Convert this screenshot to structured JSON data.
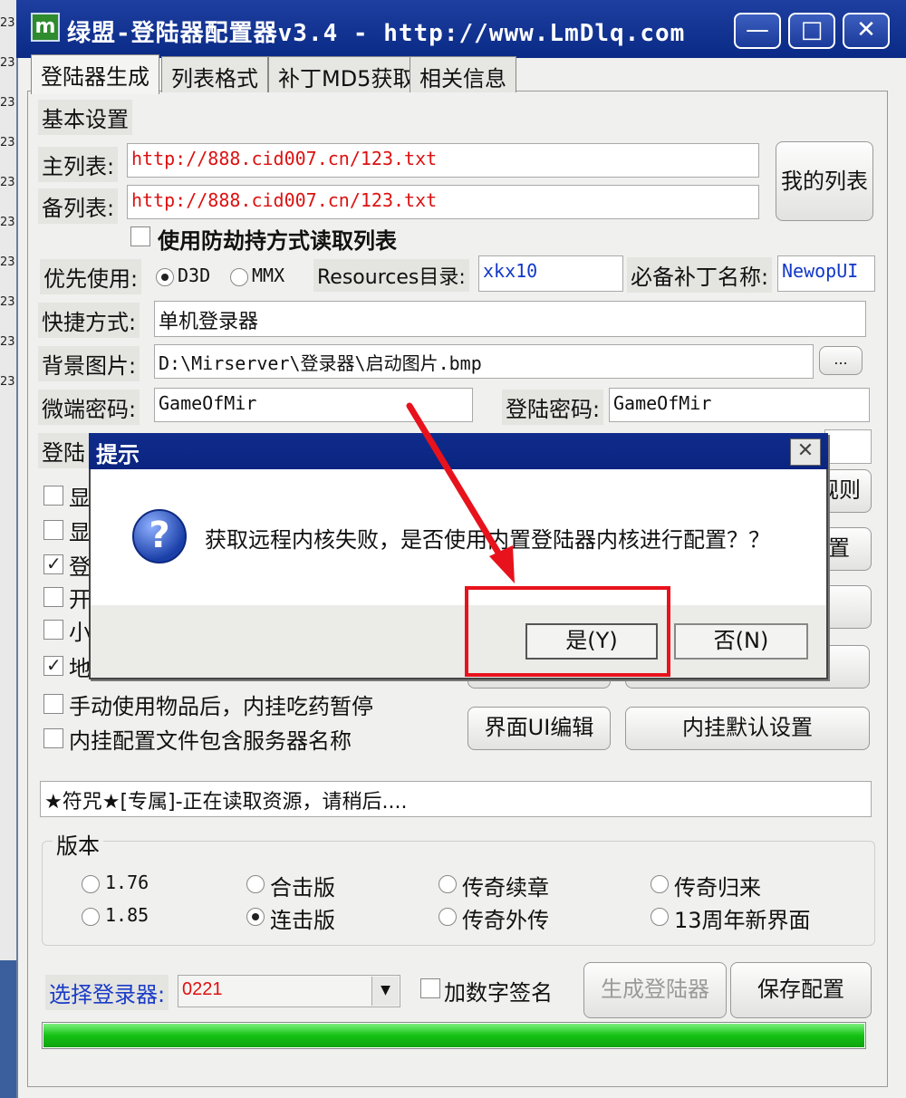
{
  "window": {
    "title": "绿盟-登陆器配置器v3.4 - http://www.LmDlq.com",
    "controls": {
      "minimize": "—",
      "maximize": "□",
      "close": "✕"
    },
    "left_edge_fragments": [
      "23",
      "23",
      "23",
      "23",
      "23",
      "23",
      "23",
      "23",
      "23",
      "23"
    ]
  },
  "tabs": [
    {
      "label": "登陆器生成"
    },
    {
      "label": "列表格式"
    },
    {
      "label": "补丁MD5获取"
    },
    {
      "label": "相关信息"
    }
  ],
  "basic": {
    "section_label": "基本设置",
    "main_list_label": "主列表:",
    "main_list_value": "http://888.cid007.cn/123.txt",
    "backup_list_label": "备列表:",
    "backup_list_value": "http://888.cid007.cn/123.txt",
    "my_list_button": "我的列表",
    "anti_hijack_label": "使用防劫持方式读取列表",
    "priority_label": "优先使用:",
    "priority_options": [
      "D3D",
      "MMX"
    ],
    "resources_label": "Resources目录:",
    "resources_value": "xkx10",
    "required_patch_label": "必备补丁名称:",
    "required_patch_value": "NewopUI",
    "shortcut_label": "快捷方式:",
    "shortcut_value": "单机登录器",
    "bg_image_label": "背景图片:",
    "bg_image_value": "D:\\Mirserver\\登录器\\启动图片.bmp",
    "browse_button": "...",
    "micro_pwd_label": "微端密码:",
    "micro_pwd_value": "GameOfMir",
    "login_pwd_label": "登陆密码:",
    "login_pwd_value": "GameOfMir",
    "partial_label": "登陆",
    "partial_rules": "规则",
    "partial_config": "置"
  },
  "checkboxes": {
    "partial": [
      "显",
      "显",
      "登",
      "开",
      "小",
      "地"
    ],
    "manual_items": "手动使用物品后，内挂吃药暂停",
    "config_server_name": "内挂配置文件包含服务器名称"
  },
  "buttons": {
    "ui_edit": "界面UI编辑",
    "plugin_default": "内挂默认设置"
  },
  "status": "★符咒★[专属]-正在读取资源，请稍后....",
  "version": {
    "title": "版本",
    "options": [
      [
        "1.76",
        "合击版",
        "传奇续章",
        "传奇归来"
      ],
      [
        "1.85",
        "连击版",
        "传奇外传",
        "13周年新界面"
      ]
    ]
  },
  "bottom": {
    "select_label": "选择登录器:",
    "select_value": "0221",
    "digital_sign_label": "加数字签名",
    "generate_button": "生成登陆器",
    "save_button": "保存配置",
    "progress": 1.0
  },
  "dialog": {
    "title": "提示",
    "close": "✕",
    "icon": "question-icon",
    "message": "获取远程内核失败，是否使用内置登陆器内核进行配置？？",
    "yes": "是(Y)",
    "no": "否(N)"
  },
  "colors": {
    "titlebar": "#0a2a86",
    "highlight": "#e8121c",
    "progress": "#14c214",
    "url_red": "#d11111",
    "value_blue": "#1238c8"
  }
}
